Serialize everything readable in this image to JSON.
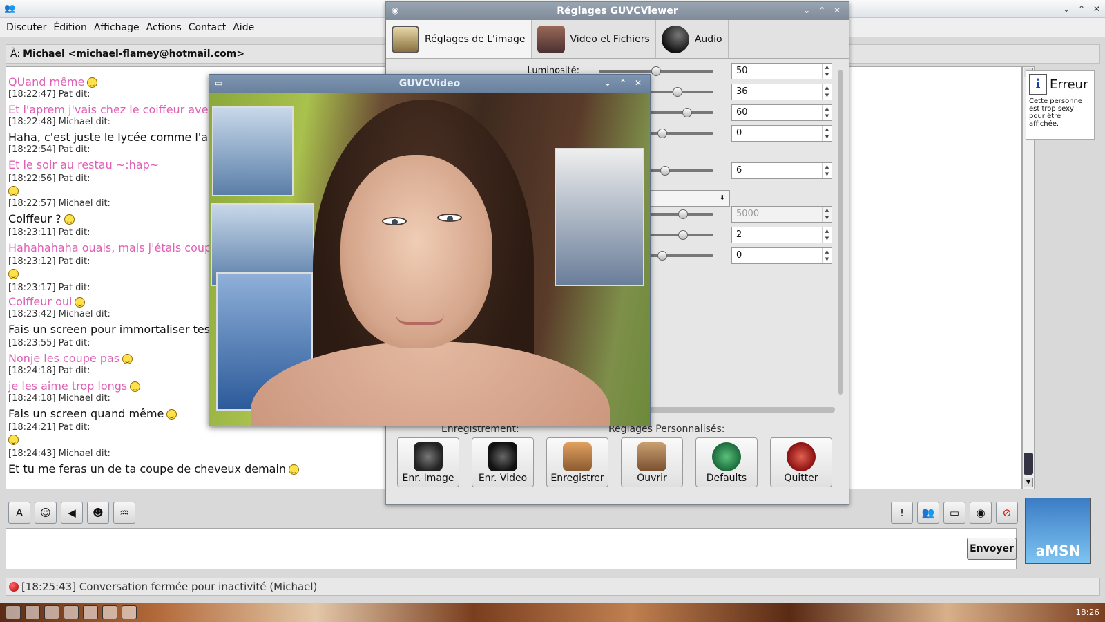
{
  "amsn": {
    "menu": [
      "Discuter",
      "Édition",
      "Affichage",
      "Actions",
      "Contact",
      "Aide"
    ],
    "to_label": "À:",
    "to_contact": "Michael <michael-flamey@hotmail.com>",
    "messages": [
      {
        "type": "text",
        "who": "pat",
        "text": "QUand même",
        "emo": true
      },
      {
        "type": "hdr",
        "text": "[18:22:47] Pat dit:"
      },
      {
        "type": "text",
        "who": "pat",
        "text": "Et l'aprem j'vais chez le coiffeur avec"
      },
      {
        "type": "hdr",
        "text": "[18:22:48] Michael dit:"
      },
      {
        "type": "text",
        "who": "mic",
        "text": "Haha, c'est juste le lycée comme l'an"
      },
      {
        "type": "hdr",
        "text": "[18:22:54] Pat dit:"
      },
      {
        "type": "text",
        "who": "pat",
        "text": "Et le soir au restau ~:hap~"
      },
      {
        "type": "hdr",
        "text": "[18:22:56] Pat dit:"
      },
      {
        "type": "emo"
      },
      {
        "type": "hdr",
        "text": "[18:22:57] Michael dit:"
      },
      {
        "type": "text",
        "who": "mic",
        "text": "Coiffeur ?",
        "emo": true
      },
      {
        "type": "hdr",
        "text": "[18:23:11] Pat dit:"
      },
      {
        "type": "text",
        "who": "pat",
        "text": "Hahahahaha ouais, mais j'étais coup"
      },
      {
        "type": "hdr",
        "text": "[18:23:12] Pat dit:"
      },
      {
        "type": "emo"
      },
      {
        "type": "hdr",
        "text": "[18:23:17] Pat dit:"
      },
      {
        "type": "text",
        "who": "pat",
        "text": "Coiffeur oui",
        "emo": true
      },
      {
        "type": "hdr",
        "text": "[18:23:42] Michael dit:"
      },
      {
        "type": "text",
        "who": "mic",
        "text": "Fais un screen pour immortaliser tes"
      },
      {
        "type": "hdr",
        "text": "[18:23:55] Pat dit:"
      },
      {
        "type": "text",
        "who": "pat",
        "text": "Nonje les coupe pas",
        "emo": true
      },
      {
        "type": "hdr",
        "text": "[18:24:18] Pat dit:"
      },
      {
        "type": "text",
        "who": "pat",
        "text": "je les aime trop longs",
        "emo": true
      },
      {
        "type": "hdr",
        "text": "[18:24:18] Michael dit:"
      },
      {
        "type": "text",
        "who": "mic",
        "text": "Fais un screen quand même",
        "emo": true
      },
      {
        "type": "hdr",
        "text": "[18:24:21] Pat dit:"
      },
      {
        "type": "emo"
      },
      {
        "type": "hdr",
        "text": "[18:24:43] Michael dit:"
      },
      {
        "type": "text",
        "who": "mic",
        "text": "Et tu me feras un de ta coupe de cheveux demain",
        "emo": true
      }
    ],
    "error_title": "Erreur",
    "error_text": "Cette personne est trop sexy pour être affichée.",
    "send_label": "Envoyer",
    "status_text": "[18:25:43] Conversation fermée pour inactivité (Michael)",
    "avatar_text": "aMSN",
    "clock": "18:26"
  },
  "settings": {
    "title": "Réglages GUVCViewer",
    "tabs": [
      "Réglages de L'image",
      "Video et Fichiers",
      "Audio"
    ],
    "brightness_label": "Luminosité:",
    "controls": [
      {
        "value": "50",
        "level": 0.5,
        "disabled": false
      },
      {
        "value": "36",
        "level": 0.36,
        "disabled": false
      },
      {
        "value": "60",
        "level": 0.6,
        "disabled": false
      },
      {
        "value": "0",
        "level": 0.0,
        "disabled": false
      },
      {
        "value": "6",
        "level": 0.06,
        "disabled": false
      },
      {
        "value": "5000",
        "level": 0.5,
        "disabled": true
      },
      {
        "value": "2",
        "level": 0.5,
        "disabled": false
      },
      {
        "value": "0",
        "level": 0.0,
        "disabled": false
      }
    ],
    "section_record": "Enregistrement:",
    "section_custom": "Réglages Personnalisés:",
    "buttons": [
      "Enr. Image",
      "Enr. Video",
      "Enregistrer",
      "Ouvrir",
      "Defaults",
      "Quitter"
    ]
  },
  "video": {
    "title": "GUVCVideo"
  }
}
